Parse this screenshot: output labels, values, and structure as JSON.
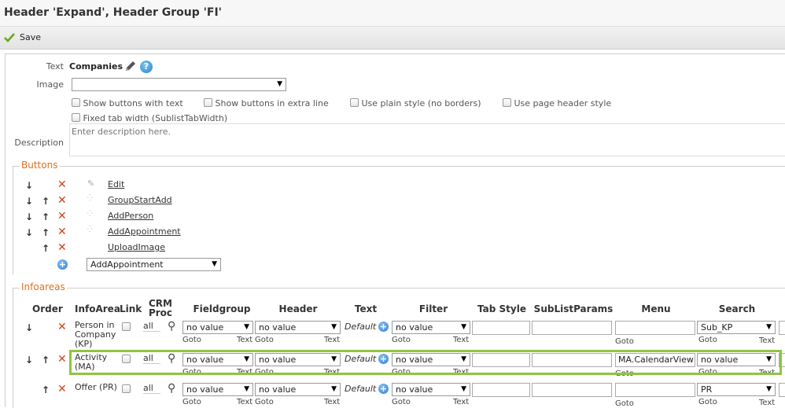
{
  "title": "Header 'Expand', Header Group 'FI'",
  "toolbar": {
    "save_label": "Save"
  },
  "form": {
    "text_label": "Text",
    "text_value": "Companies",
    "image_label": "Image",
    "image_value": "",
    "options": [
      "Show buttons with text",
      "Show buttons in extra line",
      "Use plain style (no borders)",
      "Use page header style",
      "Fixed tab width (SublistTabWidth)"
    ],
    "description_label": "Description",
    "description_placeholder": "Enter description here."
  },
  "buttons": {
    "legend": "Buttons",
    "items": [
      {
        "name": "Edit",
        "down": true,
        "up": false
      },
      {
        "name": "GroupStartAdd",
        "down": true,
        "up": true
      },
      {
        "name": "AddPerson",
        "down": true,
        "up": true
      },
      {
        "name": "AddAppointment",
        "down": true,
        "up": true
      },
      {
        "name": "UploadImage",
        "down": false,
        "up": true
      }
    ],
    "add_select_value": "AddAppointment"
  },
  "infoareas": {
    "legend": "Infoareas",
    "headers": {
      "order": "Order",
      "infoarea": "InfoArea",
      "link": "Link",
      "crm_proc": "CRM Proc",
      "fieldgroup": "Fieldgroup",
      "header": "Header",
      "text": "Text",
      "filter": "Filter",
      "tab_style": "Tab Style",
      "sublistparams": "SubListParams",
      "menu": "Menu",
      "search": "Search"
    },
    "sub_labels": {
      "goto": "Goto",
      "text": "Text"
    },
    "rows": [
      {
        "infoarea": "Person in Company (KP)",
        "crm": "all",
        "fieldgroup": "no value",
        "header": "no value",
        "text": "Default",
        "filter": "no value",
        "tab_style": "",
        "sublistparams": "",
        "menu": "",
        "search": "Sub_KP"
      },
      {
        "infoarea": "Activity (MA)",
        "crm": "all",
        "fieldgroup": "no value",
        "header": "no value",
        "text": "Default",
        "filter": "no value",
        "tab_style": "",
        "sublistparams": "",
        "menu": "MA.CalendarView",
        "search": "no value"
      },
      {
        "infoarea": "Offer (PR)",
        "crm": "all",
        "fieldgroup": "no value",
        "header": "no value",
        "text": "Default",
        "filter": "no value",
        "tab_style": "",
        "sublistparams": "",
        "menu": "",
        "search": "PR"
      }
    ]
  },
  "colors": {
    "accent_orange": "#e1701e",
    "highlight_green": "#8cc63f",
    "delete_red": "#d0451b",
    "save_check": "#6aa61e"
  }
}
